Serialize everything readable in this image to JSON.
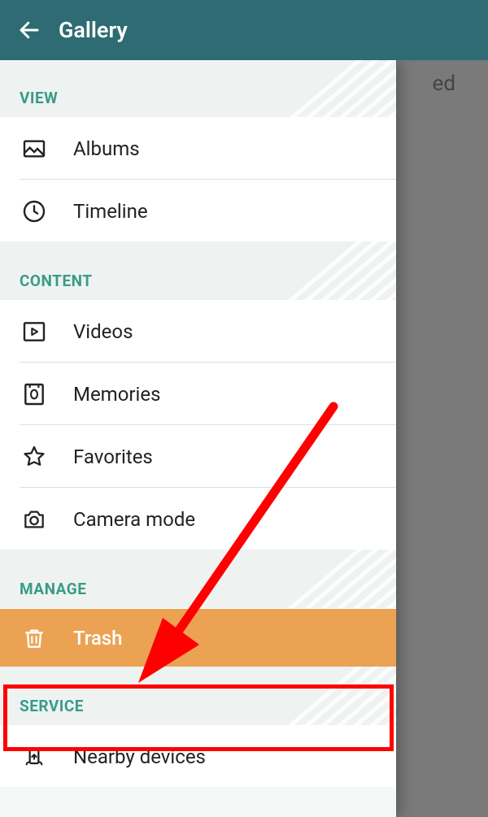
{
  "header": {
    "title": "Gallery"
  },
  "bg_fragment": "ed",
  "sections": {
    "view": {
      "label": "VIEW",
      "items": {
        "albums": "Albums",
        "timeline": "Timeline"
      }
    },
    "content": {
      "label": "CONTENT",
      "items": {
        "videos": "Videos",
        "memories": "Memories",
        "favorites": "Favorites",
        "camera_mode": "Camera mode"
      }
    },
    "manage": {
      "label": "MANAGE",
      "items": {
        "trash": "Trash"
      }
    },
    "service": {
      "label": "SERVICE",
      "items": {
        "nearby": "Nearby devices"
      }
    }
  },
  "annotation": {
    "highlight_color": "#ff0000",
    "arrow_color": "#ff0000",
    "highlight_target": "trash"
  }
}
